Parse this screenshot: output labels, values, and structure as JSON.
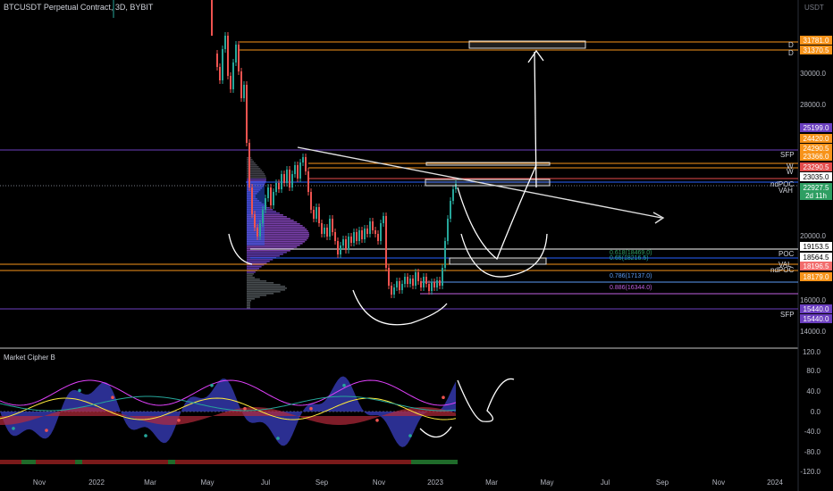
{
  "header": {
    "symbol_title": "BTCUSDT Perpetual Contract, 3D, BYBIT",
    "currency": "USDT"
  },
  "price_axis": {
    "ticks": [
      "30000.0",
      "28000.0",
      "20000.0",
      "18000.0",
      "16000.0",
      "14000.0"
    ],
    "badges": [
      {
        "label": "31781.0",
        "color": "#f7931a"
      },
      {
        "label": "31370.5",
        "color": "#f7931a"
      },
      {
        "label": "25199.0",
        "color": "#6b3fbf"
      },
      {
        "label": "24420.0",
        "color": "#f7931a"
      },
      {
        "label": "24290.5",
        "color": "#f7931a"
      },
      {
        "label": "23366.0",
        "color": "#f7931a"
      },
      {
        "label": "23290.5",
        "color": "#e34b4b"
      },
      {
        "label": "23035.0",
        "color": "#ffffff"
      },
      {
        "label": "22927.5",
        "color": "#2e9e62"
      },
      {
        "label": "2d 11h",
        "color": "#2e9e62"
      },
      {
        "label": "19153.5",
        "color": "#ffffff"
      },
      {
        "label": "18564.5",
        "color": "#ffffff"
      },
      {
        "label": "18196.5",
        "color": "#f26d6d"
      },
      {
        "label": "18179.0",
        "color": "#f7931a"
      },
      {
        "label": "15440.0",
        "color": "#6b3fbf"
      },
      {
        "label": "15440.0",
        "color": "#6b3fbf"
      }
    ]
  },
  "level_labels": {
    "d1": "D",
    "d2": "D",
    "sfp_top": "SFP",
    "w1": "W",
    "w2": "W",
    "ndpoc": "ndPOC",
    "vah": "VAH",
    "poc": "POC",
    "val": "VAL",
    "ndpoc2": "ndPOC",
    "sfp_bottom": "SFP"
  },
  "fib_labels": {
    "f618": "0.618(18469.0)",
    "f65": "0.65(18216.5)",
    "f786": "0.786(17137.0)",
    "f886": "0.886(16344.0)"
  },
  "indicator": {
    "title": "Market Cipher B",
    "ticks": [
      "120.0",
      "80.0",
      "40.0",
      "0.0",
      "-40.0",
      "-80.0",
      "-120.0"
    ]
  },
  "time_axis": {
    "labels": [
      "Nov",
      "2022",
      "Mar",
      "May",
      "Jul",
      "Sep",
      "Nov",
      "2023",
      "Mar",
      "May",
      "Jul",
      "Sep",
      "Nov",
      "2024"
    ]
  },
  "colors": {
    "bull": "#26a69a",
    "bear": "#ef5350",
    "volume_profile": "#8e4ac8"
  }
}
